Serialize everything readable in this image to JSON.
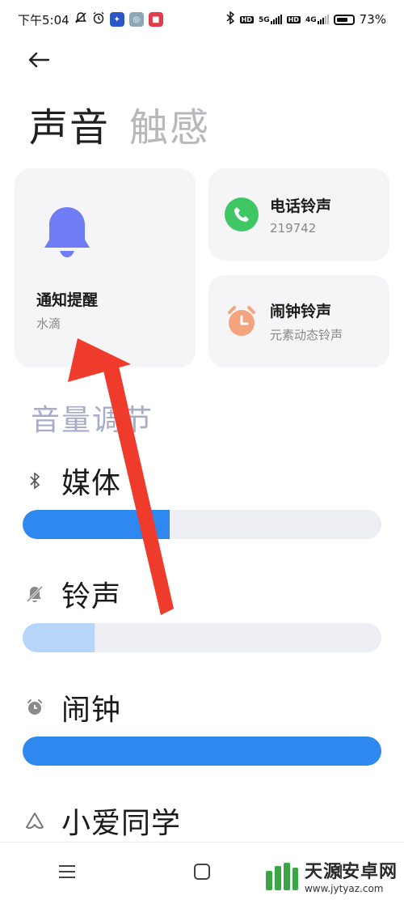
{
  "status_bar": {
    "time": "下午5:04",
    "network_5g": "5G",
    "network_4g": "4G",
    "hd": "HD",
    "battery_percent": "73%",
    "battery_level": 0.73
  },
  "header": {
    "tabs": [
      {
        "label": "声音",
        "active": true
      },
      {
        "label": "触感",
        "active": false
      }
    ]
  },
  "cards": {
    "notification": {
      "title": "通知提醒",
      "subtitle": "水滴",
      "icon": "bell-icon",
      "color": "#6f7cf3"
    },
    "phone": {
      "title": "电话铃声",
      "subtitle": "219742",
      "icon": "phone-icon",
      "color": "#3ec764"
    },
    "alarm": {
      "title": "闹钟铃声",
      "subtitle": "元素动态铃声",
      "icon": "alarm-clock-icon",
      "color": "#f3a47f"
    }
  },
  "volume": {
    "section_title": "音量调节",
    "items": [
      {
        "label": "媒体",
        "icon": "bluetooth-icon",
        "level": 0.41,
        "fill_color": "#2f88ef"
      },
      {
        "label": "铃声",
        "icon": "bell-muted-icon",
        "level": 0.2,
        "fill_color": "#b7d5f8"
      },
      {
        "label": "闹钟",
        "icon": "alarm-clock-icon",
        "level": 1.0,
        "fill_color": "#2f88ef"
      },
      {
        "label": "小爱同学",
        "icon": "xiaoai-icon"
      }
    ]
  },
  "watermark": {
    "name": "天源安卓网",
    "url": "www.jytyaz.com"
  },
  "colors": {
    "accent": "#2f88ef",
    "annotation_arrow": "#ee3b2b"
  }
}
